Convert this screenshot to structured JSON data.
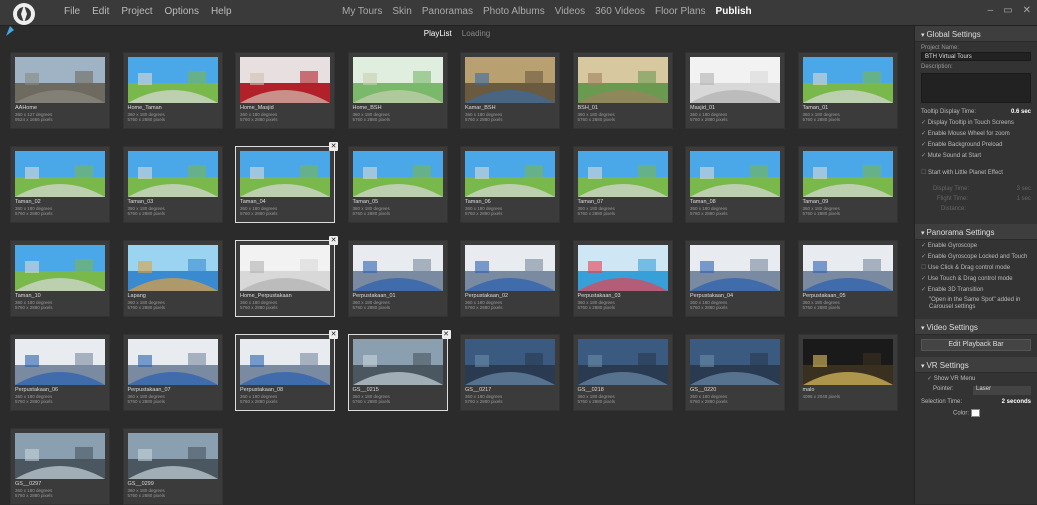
{
  "menu": [
    "File",
    "Edit",
    "Project",
    "Options",
    "Help"
  ],
  "nav": [
    "My Tours",
    "Skin",
    "Panoramas",
    "Photo Albums",
    "Videos",
    "360 Videos",
    "Floor Plans",
    "Publish"
  ],
  "nav_active": "Publish",
  "window_controls": [
    "–",
    "▭",
    "✕"
  ],
  "subtabs": [
    "PlayList",
    "Loading"
  ],
  "subtab_active": "PlayList",
  "gallery": {
    "close_glyph": "✕",
    "tiles": [
      {
        "name": "AAHome",
        "deg": "360 x 127 degrees",
        "px": "9524 x 1666 pixels",
        "scene": "street"
      },
      {
        "name": "Home_Taman",
        "deg": "360 x 180 degrees",
        "px": "5760 x 2880 pixels",
        "scene": "park"
      },
      {
        "name": "Home_Masjid",
        "deg": "360 x 180 degrees",
        "px": "5760 x 2880 pixels",
        "scene": "red"
      },
      {
        "name": "Home_BSH",
        "deg": "360 x 180 degrees",
        "px": "5760 x 2880 pixels",
        "scene": "greenroom"
      },
      {
        "name": "Kamar_BSH",
        "deg": "360 x 180 degrees",
        "px": "5760 x 2880 pixels",
        "scene": "room"
      },
      {
        "name": "BSH_01",
        "deg": "360 x 180 degrees",
        "px": "5760 x 2880 pixels",
        "scene": "hall"
      },
      {
        "name": "Masjid_01",
        "deg": "360 x 180 degrees",
        "px": "5760 x 2880 pixels",
        "scene": "white"
      },
      {
        "name": "Taman_01",
        "deg": "360 x 180 degrees",
        "px": "5760 x 2880 pixels",
        "scene": "park"
      },
      {
        "name": "Taman_02",
        "deg": "360 x 180 degrees",
        "px": "5760 x 2880 pixels",
        "scene": "park"
      },
      {
        "name": "Taman_03",
        "deg": "360 x 180 degrees",
        "px": "5760 x 2880 pixels",
        "scene": "park"
      },
      {
        "name": "Taman_04",
        "deg": "360 x 180 degrees",
        "px": "5760 x 2880 pixels",
        "scene": "park",
        "selected": true
      },
      {
        "name": "Taman_05",
        "deg": "360 x 180 degrees",
        "px": "5760 x 2880 pixels",
        "scene": "park"
      },
      {
        "name": "Taman_06",
        "deg": "360 x 180 degrees",
        "px": "5760 x 2880 pixels",
        "scene": "park"
      },
      {
        "name": "Taman_07",
        "deg": "360 x 180 degrees",
        "px": "5760 x 2880 pixels",
        "scene": "park"
      },
      {
        "name": "Taman_08",
        "deg": "360 x 180 degrees",
        "px": "5760 x 2880 pixels",
        "scene": "park"
      },
      {
        "name": "Taman_09",
        "deg": "360 x 180 degrees",
        "px": "5760 x 2880 pixels",
        "scene": "park"
      },
      {
        "name": "Taman_10",
        "deg": "360 x 180 degrees",
        "px": "5760 x 2880 pixels",
        "scene": "park"
      },
      {
        "name": "Lapang",
        "deg": "360 x 180 degrees",
        "px": "5760 x 2880 pixels",
        "scene": "court"
      },
      {
        "name": "Home_Perpustakaan",
        "deg": "360 x 180 degrees",
        "px": "5760 x 2880 pixels",
        "scene": "white",
        "selected": true
      },
      {
        "name": "Perpustakaan_01",
        "deg": "360 x 180 degrees",
        "px": "5760 x 2880 pixels",
        "scene": "library"
      },
      {
        "name": "Perpustakaan_02",
        "deg": "360 x 180 degrees",
        "px": "5760 x 2880 pixels",
        "scene": "library"
      },
      {
        "name": "Perpustakaan_03",
        "deg": "360 x 180 degrees",
        "px": "5760 x 2880 pixels",
        "scene": "kids"
      },
      {
        "name": "Perpustakaan_04",
        "deg": "360 x 180 degrees",
        "px": "5760 x 2880 pixels",
        "scene": "library"
      },
      {
        "name": "Perpustakaan_05",
        "deg": "360 x 180 degrees",
        "px": "5760 x 2880 pixels",
        "scene": "library"
      },
      {
        "name": "Perpustakaan_06",
        "deg": "360 x 180 degrees",
        "px": "5760 x 2880 pixels",
        "scene": "library"
      },
      {
        "name": "Perpustakaan_07",
        "deg": "360 x 180 degrees",
        "px": "5760 x 2880 pixels",
        "scene": "library"
      },
      {
        "name": "Perpustakaan_08",
        "deg": "360 x 180 degrees",
        "px": "5760 x 2880 pixels",
        "scene": "library",
        "selected": true
      },
      {
        "name": "GS__0215",
        "deg": "360 x 180 degrees",
        "px": "5760 x 2880 pixels",
        "scene": "garage",
        "selected": true
      },
      {
        "name": "GS__0217",
        "deg": "360 x 180 degrees",
        "px": "5760 x 2880 pixels",
        "scene": "dark"
      },
      {
        "name": "GS__0218",
        "deg": "360 x 180 degrees",
        "px": "5760 x 2880 pixels",
        "scene": "dark"
      },
      {
        "name": "GS__0220",
        "deg": "360 x 180 degrees",
        "px": "5760 x 2880 pixels",
        "scene": "dark"
      },
      {
        "name": "malo",
        "deg": "",
        "px": "4096 x 2048 pixels",
        "scene": "night"
      },
      {
        "name": "GS__0297",
        "deg": "360 x 180 degrees",
        "px": "5760 x 2880 pixels",
        "scene": "garage"
      },
      {
        "name": "GS__0299",
        "deg": "360 x 180 degrees",
        "px": "5760 x 2880 pixels",
        "scene": "garage"
      }
    ]
  },
  "global": {
    "header": "Global Settings",
    "project_name_label": "Project Name:",
    "project_name": "BTH Virtual Tours",
    "description_label": "Description:",
    "tooltip_label": "Tooltip Display Time:",
    "tooltip_value": "0.6 sec",
    "options": [
      "Display Tooltip in Touch Screens",
      "Enable Mouse Wheel for zoom",
      "Enable Background Preload",
      "Mute Sound at Start"
    ],
    "little_planet": "Start with Little Planet Effect",
    "display_time_label": "Display Time:",
    "display_time_value": "3 sec",
    "flight_time_label": "Flight Time:",
    "flight_time_value": "1 sec",
    "distance_label": "Distance:"
  },
  "panorama": {
    "header": "Panorama Settings",
    "options": [
      "Enable Gyroscope",
      "Enable Gyroscope Locked and Touch",
      "Use Click & Drag control mode",
      "Use Touch & Drag control mode",
      "Enable 3D Transition"
    ],
    "same_spot": "\"Open in the Same Spot\" added in Carousel settings"
  },
  "video": {
    "header": "Video Settings",
    "edit_button": "Edit Playback Bar"
  },
  "vr": {
    "header": "VR Settings",
    "show_menu": "Show VR Menu",
    "pointer_label": "Pointer:",
    "pointer_value": "Laser",
    "selection_label": "Selection Time:",
    "selection_value": "2 seconds",
    "color_label": "Color:"
  }
}
